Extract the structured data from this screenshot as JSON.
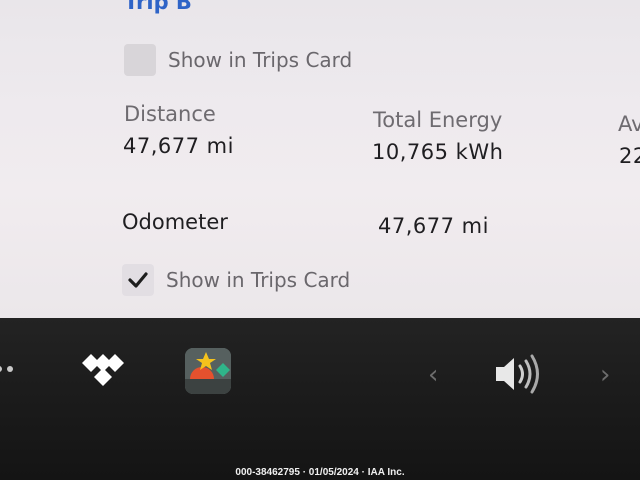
{
  "trip": {
    "title": "Trip B",
    "show_in_trips_card": "Show in Trips Card",
    "show_checked": false
  },
  "stats": {
    "distance": {
      "label": "Distance",
      "value": "47,677 mi"
    },
    "total_energy": {
      "label": "Total Energy",
      "value": "10,765 kWh"
    },
    "avg": {
      "label": "Av",
      "value": "22"
    }
  },
  "odometer": {
    "label": "Odometer",
    "value": "47,677 mi",
    "show_in_trips_card": "Show in Trips Card",
    "show_checked": true
  },
  "taskbar": {
    "icons": [
      "dots-icon",
      "tidal-icon",
      "toybox-icon",
      "chevron-left-icon",
      "volume-icon",
      "chevron-right-icon"
    ]
  },
  "footer": {
    "caption": "000-38462795 · 01/05/2024 · IAA Inc."
  }
}
